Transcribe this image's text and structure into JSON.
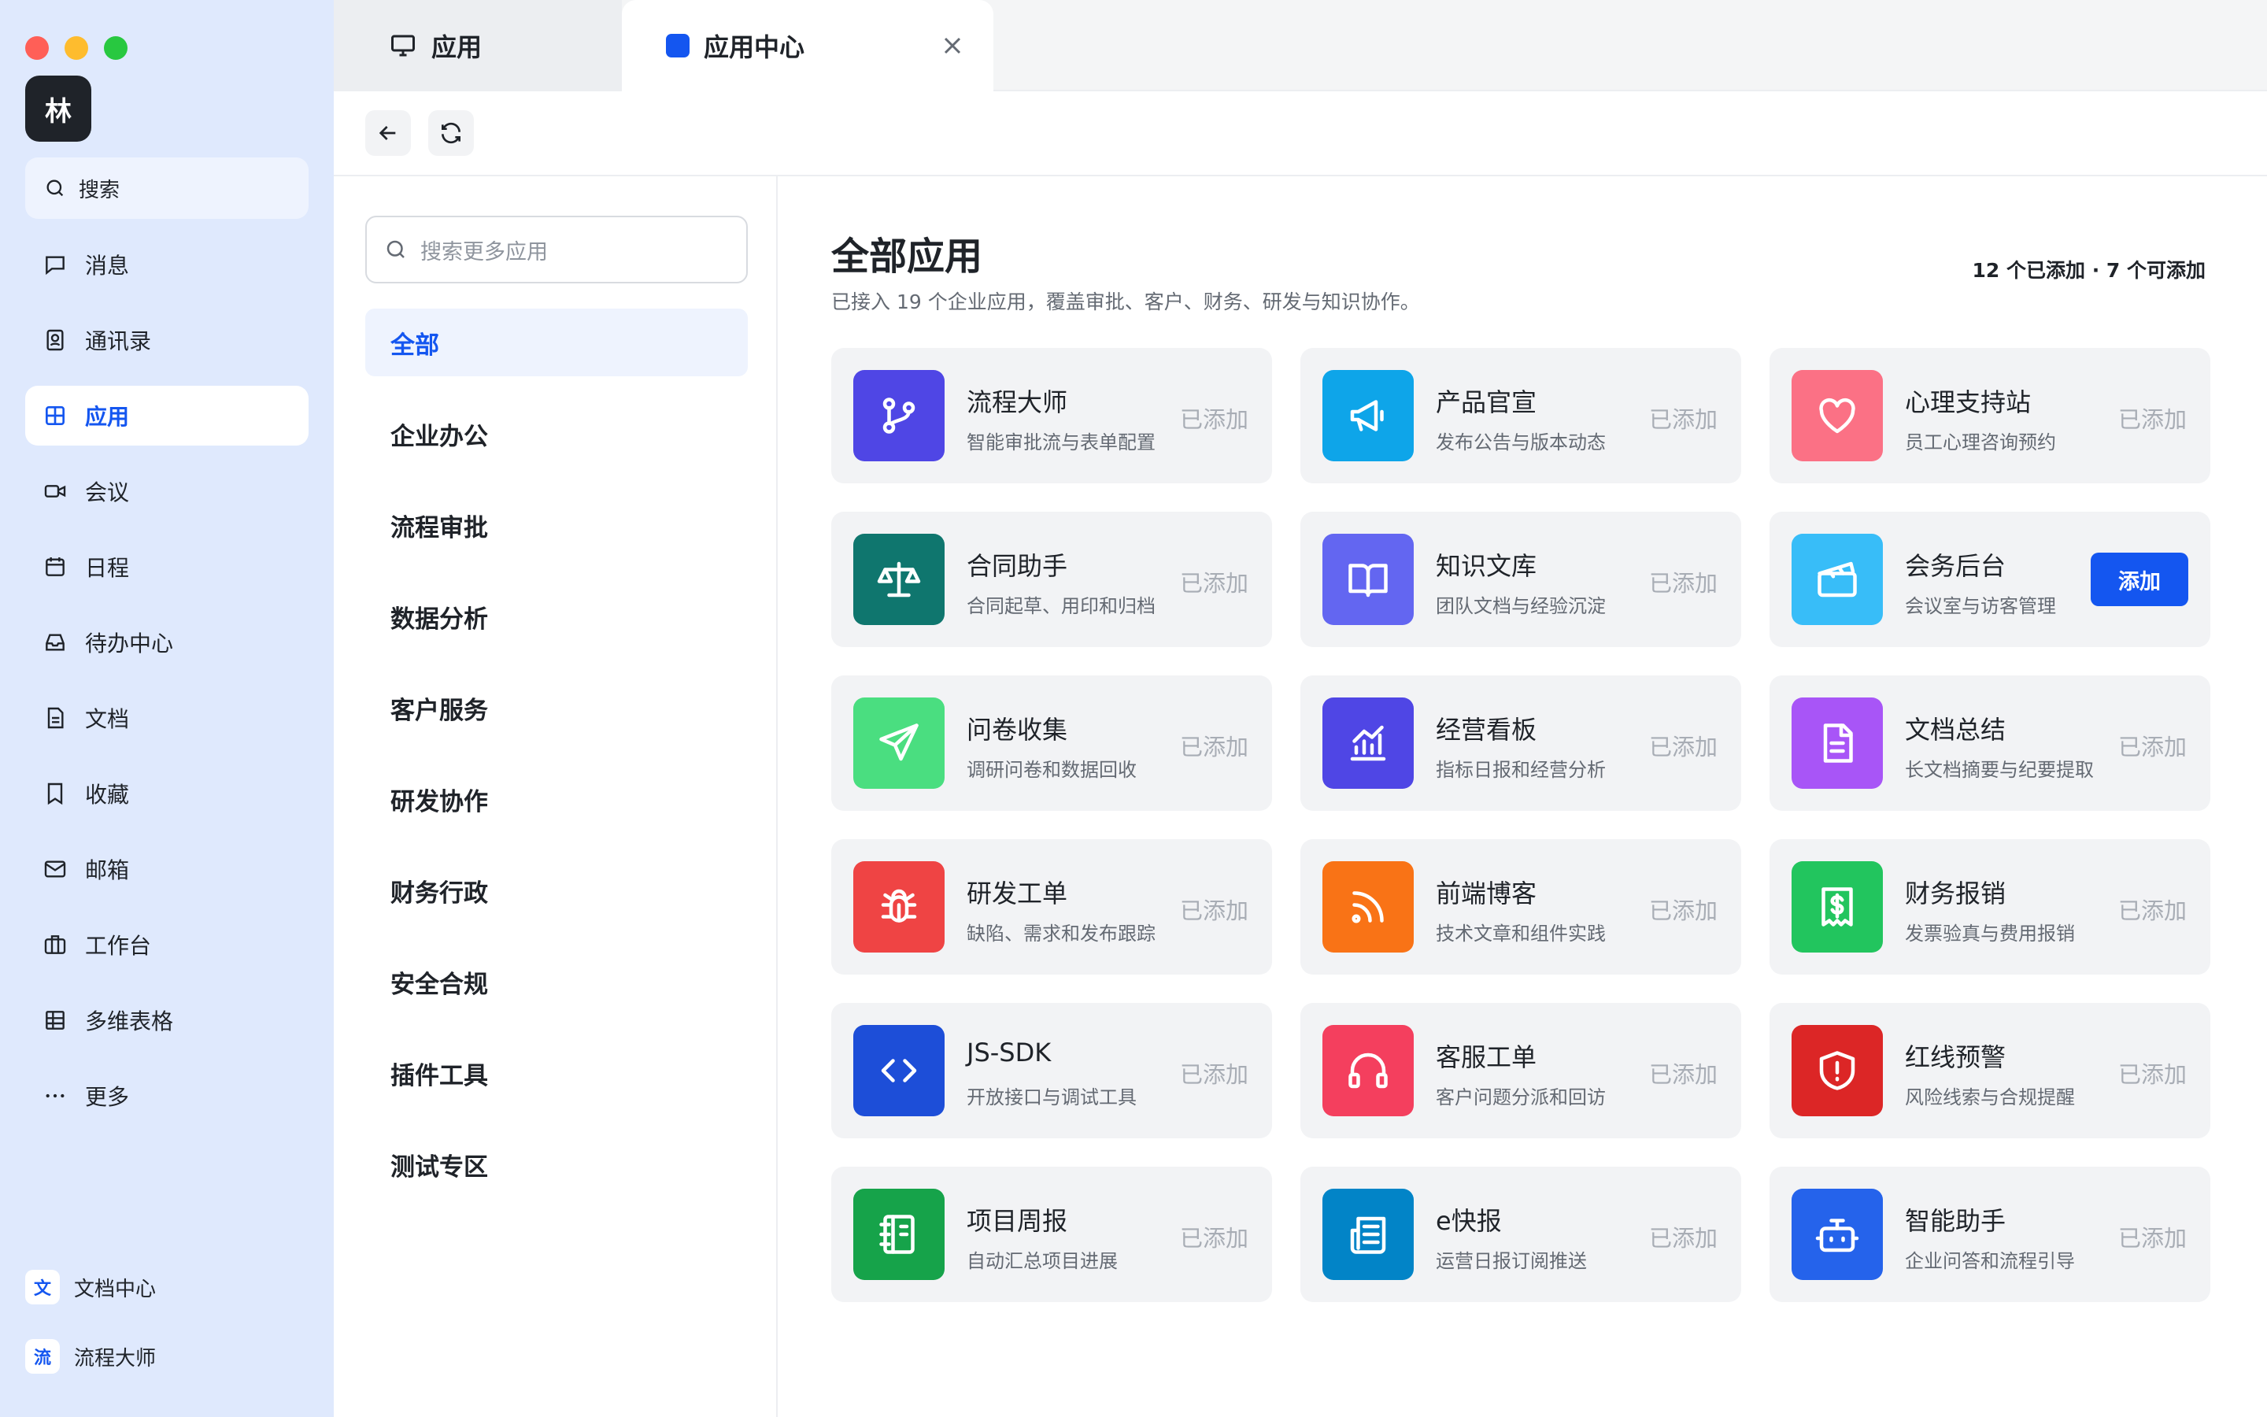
{
  "sidebar": {
    "avatar_text": "林",
    "search_label": "搜索",
    "items": [
      {
        "label": "消息",
        "icon": "message-icon"
      },
      {
        "label": "通讯录",
        "icon": "contacts-icon"
      },
      {
        "label": "应用",
        "icon": "apps-grid-icon",
        "active": true
      },
      {
        "label": "会议",
        "icon": "video-icon"
      },
      {
        "label": "日程",
        "icon": "calendar-icon"
      },
      {
        "label": "待办中心",
        "icon": "inbox-icon"
      },
      {
        "label": "文档",
        "icon": "document-icon"
      },
      {
        "label": "收藏",
        "icon": "bookmark-icon"
      },
      {
        "label": "邮箱",
        "icon": "mail-icon"
      },
      {
        "label": "工作台",
        "icon": "briefcase-icon"
      },
      {
        "label": "多维表格",
        "icon": "table-icon"
      },
      {
        "label": "更多",
        "icon": "more-icon"
      }
    ],
    "pinned": [
      {
        "badge": "文",
        "label": "文档中心"
      },
      {
        "badge": "流",
        "label": "流程大师"
      }
    ]
  },
  "tabs": [
    {
      "label": "应用",
      "icon": "monitor-icon"
    },
    {
      "label": "应用中心",
      "icon": "blue-square-icon",
      "active": true
    }
  ],
  "categories": {
    "search_placeholder": "搜索更多应用",
    "items": [
      "全部",
      "企业办公",
      "流程审批",
      "数据分析",
      "客户服务",
      "研发协作",
      "财务行政",
      "安全合规",
      "插件工具",
      "测试专区"
    ],
    "active_index": 0
  },
  "main": {
    "title": "全部应用",
    "subtitle": "已接入 19 个企业应用，覆盖审批、客户、财务、研发与知识协作。",
    "counts": "12 个已添加 · 7 个可添加",
    "added_label": "已添加",
    "add_label": "添加"
  },
  "apps": [
    {
      "name": "流程大师",
      "desc": "智能审批流与表单配置",
      "icon": "git-branch-icon",
      "color": "#4f46e5",
      "added": true
    },
    {
      "name": "产品官宣",
      "desc": "发布公告与版本动态",
      "icon": "megaphone-icon",
      "color": "#0ea5e9",
      "added": true
    },
    {
      "name": "心理支持站",
      "desc": "员工心理咨询预约",
      "icon": "heart-icon",
      "color": "#fb7185",
      "added": true
    },
    {
      "name": "合同助手",
      "desc": "合同起草、用印和归档",
      "icon": "scale-icon",
      "color": "#0f766e",
      "added": true
    },
    {
      "name": "知识文库",
      "desc": "团队文档与经验沉淀",
      "icon": "book-open-icon",
      "color": "#6366f1",
      "added": true
    },
    {
      "name": "会务后台",
      "desc": "会议室与访客管理",
      "icon": "clapperboard-icon",
      "color": "#38bdf8",
      "added": false
    },
    {
      "name": "问卷收集",
      "desc": "调研问卷和数据回收",
      "icon": "send-icon",
      "color": "#4ade80",
      "added": true
    },
    {
      "name": "经营看板",
      "desc": "指标日报和经营分析",
      "icon": "bar-chart-icon",
      "color": "#4f46e5",
      "added": true
    },
    {
      "name": "文档总结",
      "desc": "长文档摘要与纪要提取",
      "icon": "file-text-icon",
      "color": "#a855f7",
      "added": true
    },
    {
      "name": "研发工单",
      "desc": "缺陷、需求和发布跟踪",
      "icon": "bug-icon",
      "color": "#ef4444",
      "added": true
    },
    {
      "name": "前端博客",
      "desc": "技术文章和组件实践",
      "icon": "rss-icon",
      "color": "#f97316",
      "added": true
    },
    {
      "name": "财务报销",
      "desc": "发票验真与费用报销",
      "icon": "receipt-icon",
      "color": "#22c55e",
      "added": true
    },
    {
      "name": "JS-SDK",
      "desc": "开放接口与调试工具",
      "icon": "code-icon",
      "color": "#1d4ed8",
      "added": true
    },
    {
      "name": "客服工单",
      "desc": "客户问题分派和回访",
      "icon": "headphones-icon",
      "color": "#f43f5e",
      "added": true
    },
    {
      "name": "红线预警",
      "desc": "风险线索与合规提醒",
      "icon": "shield-alert-icon",
      "color": "#dc2626",
      "added": true
    },
    {
      "name": "项目周报",
      "desc": "自动汇总项目进展",
      "icon": "notebook-icon",
      "color": "#16a34a",
      "added": true
    },
    {
      "name": "e快报",
      "desc": "运营日报订阅推送",
      "icon": "newspaper-icon",
      "color": "#0284c7",
      "added": true
    },
    {
      "name": "智能助手",
      "desc": "企业问答和流程引导",
      "icon": "bot-icon",
      "color": "#2563eb",
      "added": true
    }
  ]
}
